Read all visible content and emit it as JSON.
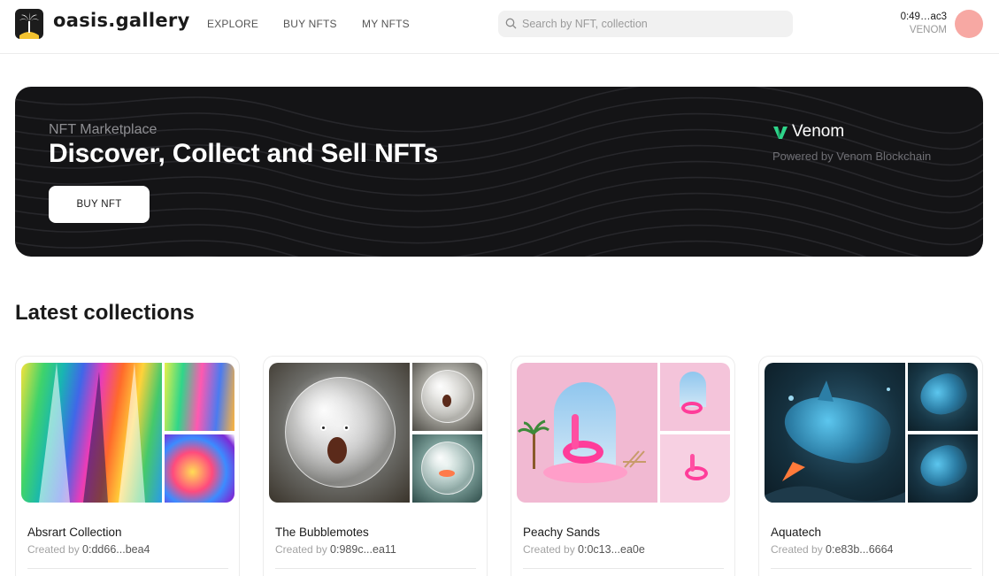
{
  "header": {
    "logo_text": "oasis.gallery",
    "nav": [
      "EXPLORE",
      "BUY NFTS",
      "MY NFTS"
    ],
    "search_placeholder": "Search by NFT, collection",
    "wallet_address": "0:49…ac3",
    "wallet_currency": "VENOM"
  },
  "hero": {
    "kicker": "NFT Marketplace",
    "title": "Discover, Collect and Sell NFTs",
    "button": "BUY NFT",
    "brand": "Venom",
    "brand_sub": "Powered by Venom Blockchain"
  },
  "collections": {
    "title": "Latest collections",
    "created_label": "Created by",
    "items": [
      {
        "name": "Absrart Collection",
        "creator": "0:dd66...bea4"
      },
      {
        "name": "The Bubblemotes",
        "creator": "0:989c...ea11"
      },
      {
        "name": "Peachy Sands",
        "creator": "0:0c13...ea0e"
      },
      {
        "name": "Aquatech",
        "creator": "0:e83b...6664"
      }
    ]
  },
  "colors": {
    "hero_bg": "#141416",
    "avatar": "#f7a8a3",
    "venom_green": "#2fd58b"
  }
}
